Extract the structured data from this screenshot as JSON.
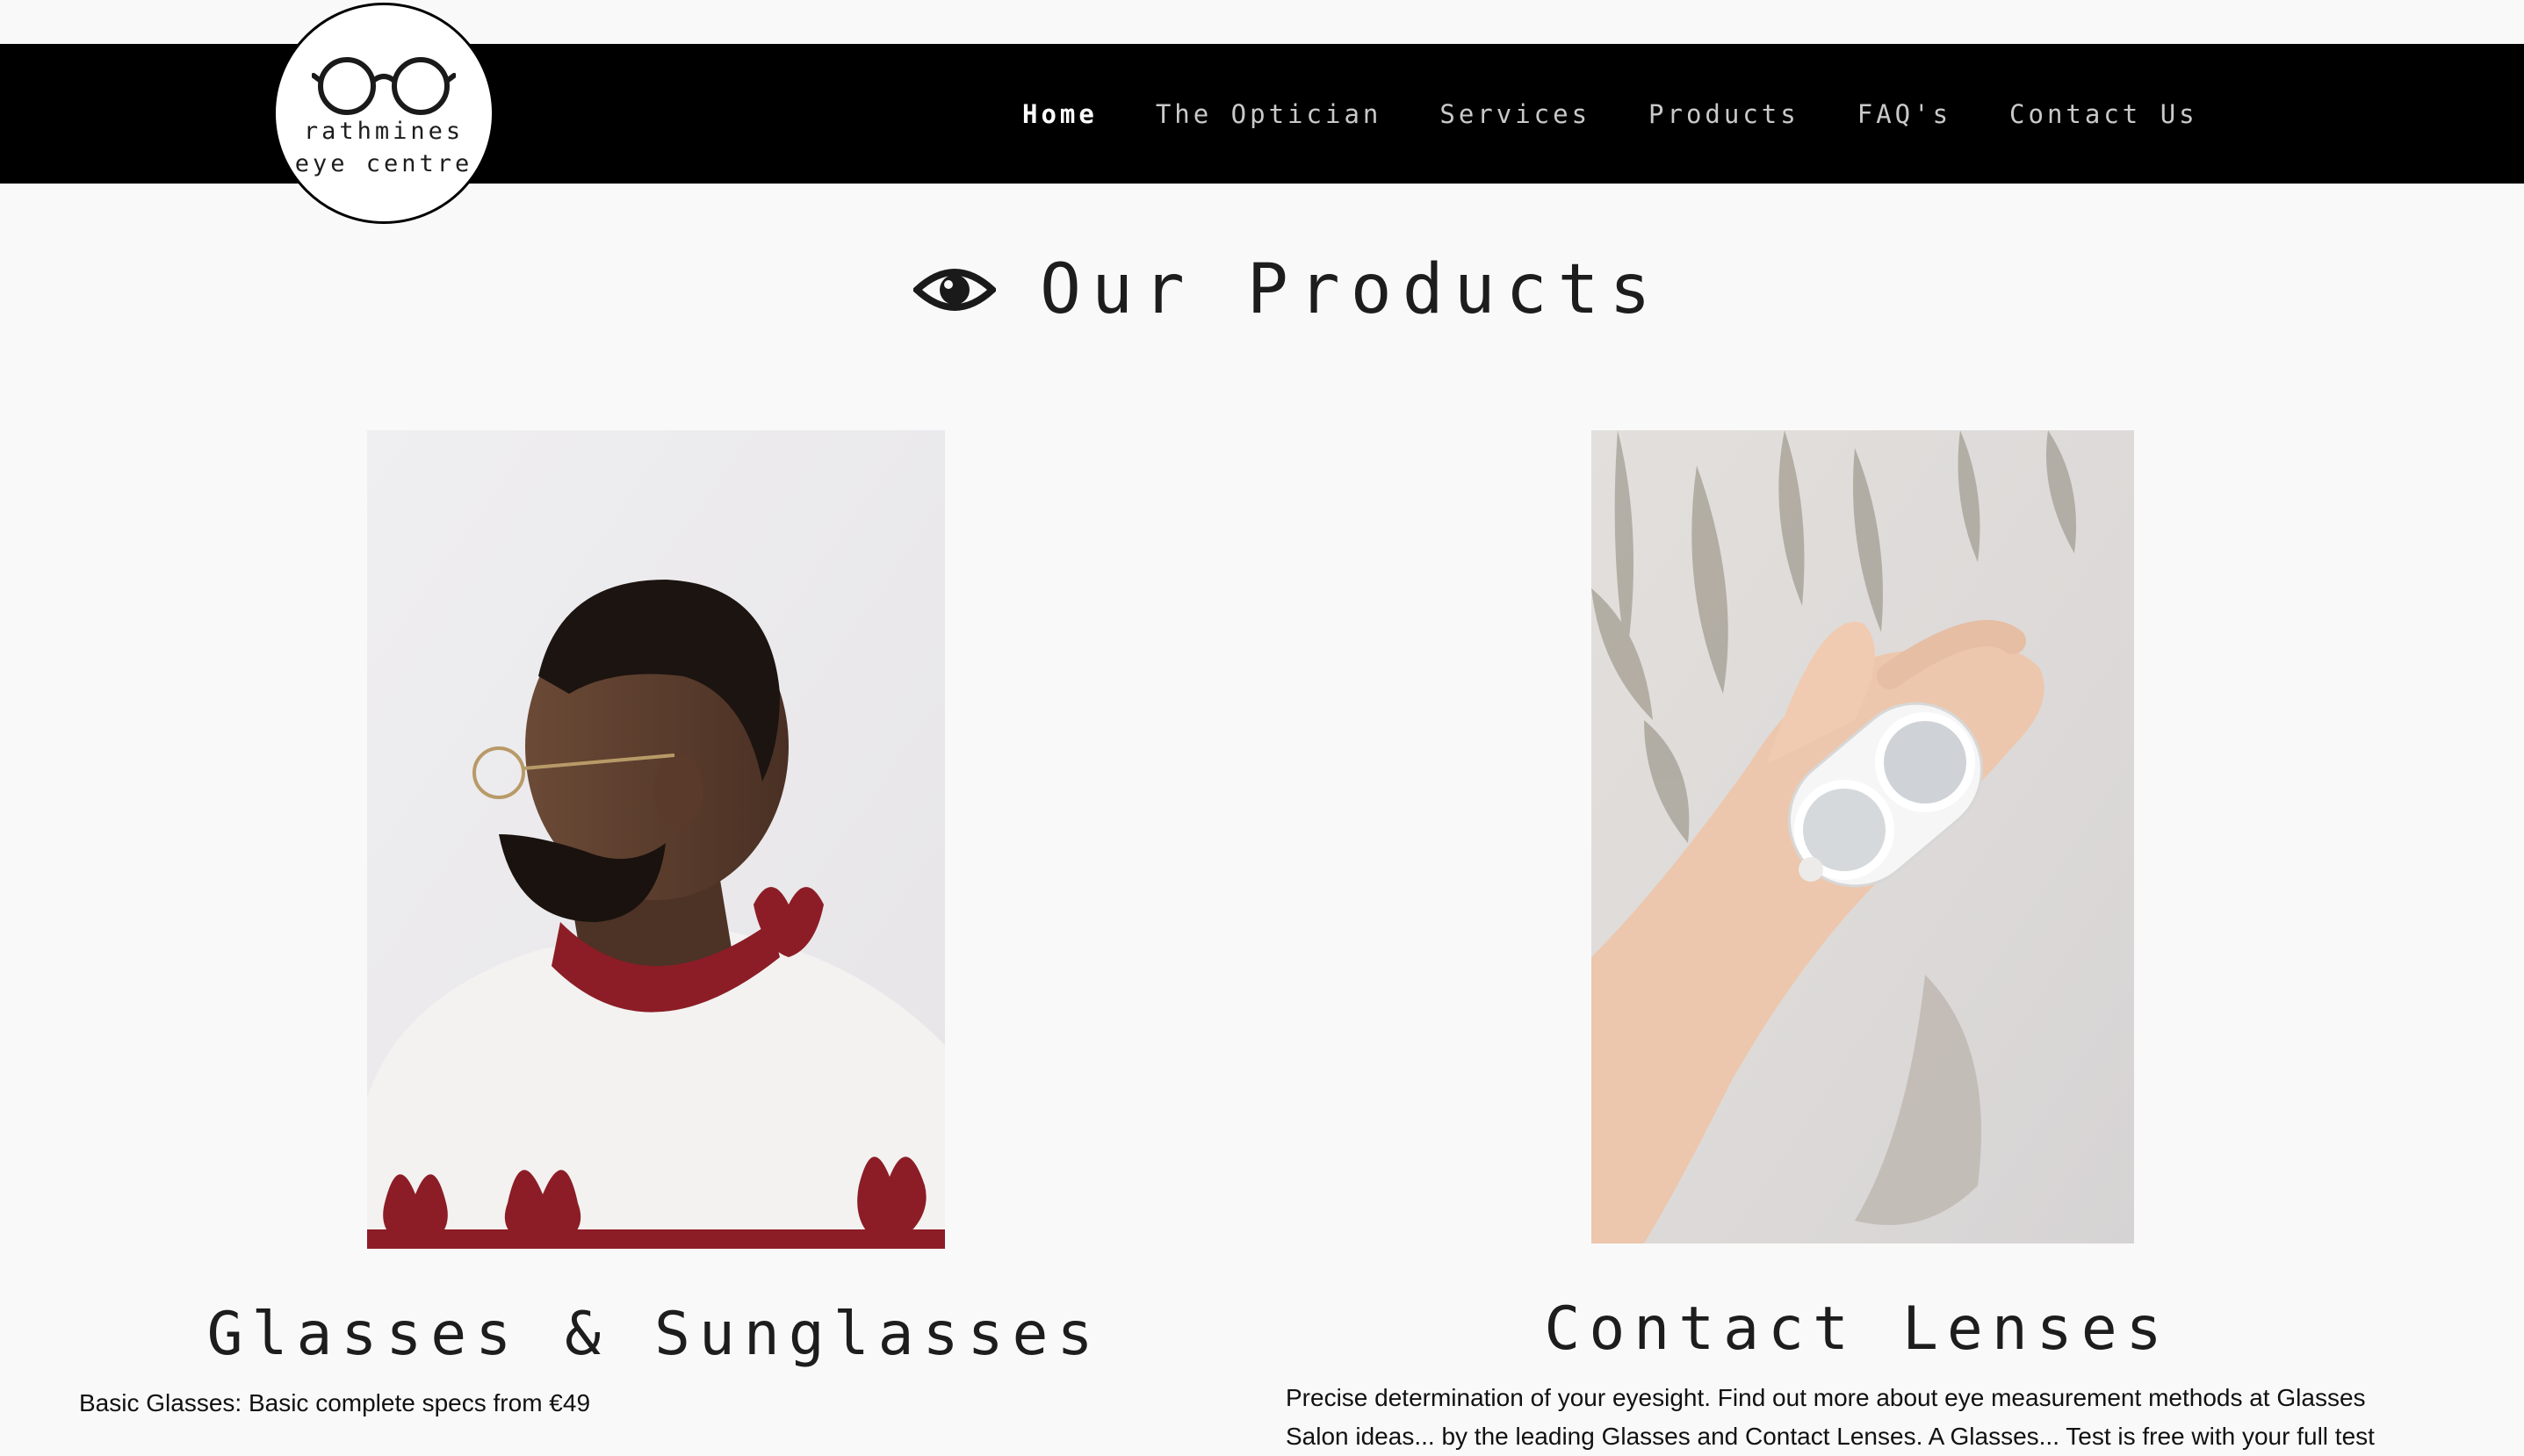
{
  "brand": {
    "logo_line1": "rathmines",
    "logo_line2": "eye centre"
  },
  "nav": {
    "items": [
      {
        "label": "Home",
        "active": true
      },
      {
        "label": "The Optician",
        "active": false
      },
      {
        "label": "Services",
        "active": false
      },
      {
        "label": "Products",
        "active": false
      },
      {
        "label": "FAQ's",
        "active": false
      },
      {
        "label": "Contact Us",
        "active": false
      }
    ]
  },
  "page": {
    "heading": "Our Products",
    "heading_icon": "eye-icon"
  },
  "products": [
    {
      "title": "Glasses & Sunglasses",
      "image": "man-wearing-glasses-photo",
      "description": "Basic Glasses: Basic complete specs from €49"
    },
    {
      "title": "Contact Lenses",
      "image": "hand-holding-contact-lens-case-photo",
      "description": "Precise determination of your eyesight. Find out more about eye measurement methods at Glasses",
      "description_cut": "Salon ideas... by the leading Glasses and Contact Lenses. A Glasses... Test is free with your full test"
    }
  ],
  "colors": {
    "navbar_bg": "#000000",
    "page_bg": "#f9f9f9",
    "nav_active": "#ffffff",
    "nav_inactive": "#c9c9c9",
    "text": "#1d1d1d"
  }
}
